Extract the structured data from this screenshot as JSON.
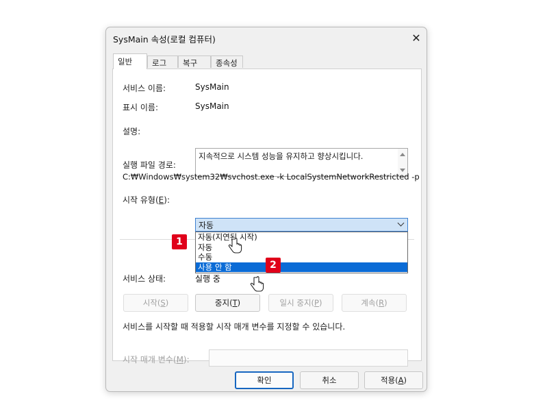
{
  "window": {
    "title": "SysMain 속성(로컬 컴퓨터)"
  },
  "tabs": [
    {
      "label": "일반",
      "active": true
    },
    {
      "label": "로그온",
      "active": false
    },
    {
      "label": "복구",
      "active": false
    },
    {
      "label": "종속성",
      "active": false
    }
  ],
  "service_name": {
    "label": "서비스 이름:",
    "value": "SysMain"
  },
  "display_name": {
    "label": "표시 이름:",
    "value": "SysMain"
  },
  "description": {
    "label": "설명:",
    "value": "지속적으로 시스템 성능을 유지하고 향상시킵니다."
  },
  "exe_path": {
    "label": "실행 파일 경로:",
    "value": "C:₩Windows₩system32₩svchost.exe -k LocalSystemNetworkRestricted -p"
  },
  "startup_type": {
    "label_prefix": "시작 유형(",
    "label_key": "E",
    "label_suffix": "):",
    "selected": "자동",
    "options": [
      "자동(지연된 시작)",
      "자동",
      "수동",
      "사용 안 함"
    ],
    "highlighted": "사용 안 함"
  },
  "status": {
    "label": "서비스 상태:",
    "value": "실행 중"
  },
  "service_buttons": [
    {
      "prefix": "시작(",
      "key": "S",
      "suffix": ")",
      "enabled": false
    },
    {
      "prefix": "중지(",
      "key": "T",
      "suffix": ")",
      "enabled": true
    },
    {
      "prefix": "일시 중지(",
      "key": "P",
      "suffix": ")",
      "enabled": false
    },
    {
      "prefix": "계속(",
      "key": "R",
      "suffix": ")",
      "enabled": false
    }
  ],
  "hint": "서비스를 시작할 때 적용할 시작 매개 변수를 지정할 수 있습니다.",
  "start_params": {
    "label_prefix": "시작 매개 변수(",
    "label_key": "M",
    "label_suffix": "):",
    "value": ""
  },
  "footer_buttons": {
    "ok": "확인",
    "cancel": "취소",
    "apply_prefix": "적용(",
    "apply_key": "A",
    "apply_suffix": ")"
  },
  "annotations": {
    "step1": "1",
    "step2": "2"
  },
  "colors": {
    "accent": "#0a6bd6",
    "badge": "#e0001a",
    "combo_bg": "#cfe3f7"
  }
}
